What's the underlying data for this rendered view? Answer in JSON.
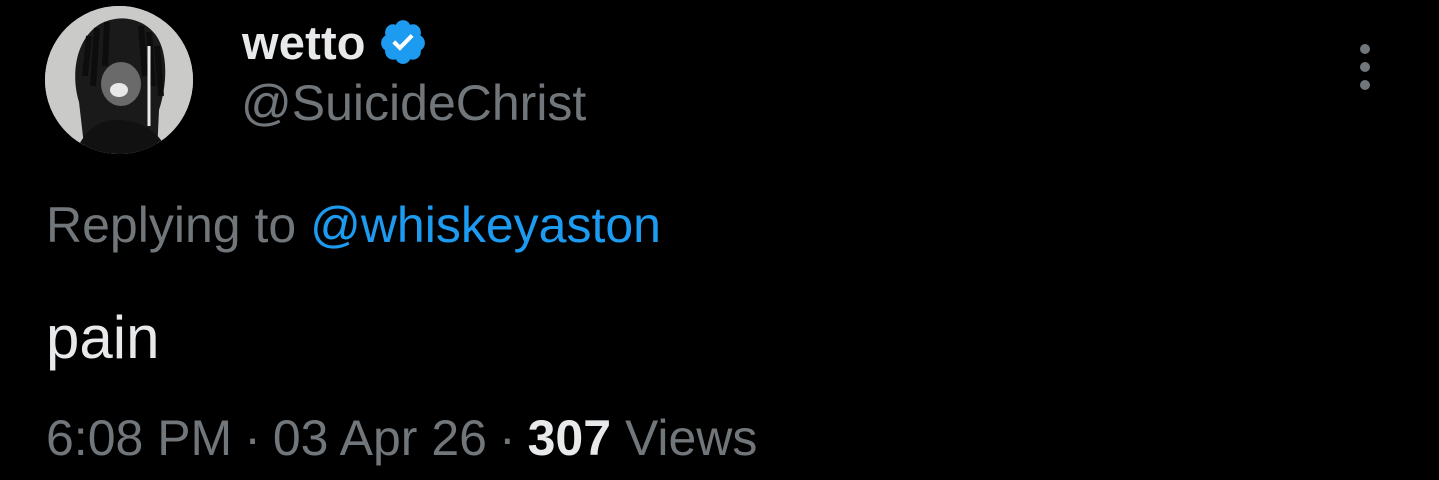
{
  "author": {
    "display_name": "wetto",
    "handle": "@SuicideChrist",
    "verified": true,
    "verified_icon": "verified-badge-icon",
    "avatar_icon": "user-avatar"
  },
  "reply": {
    "prefix": "Replying to",
    "mention": "@whiskeyaston"
  },
  "tweet": {
    "text": "pain"
  },
  "meta": {
    "time": "6:08 PM",
    "separator": "·",
    "date": "03 Apr 26",
    "views_count": "307",
    "views_label": "Views"
  },
  "more_menu": {
    "icon": "more-vertical-icon"
  },
  "colors": {
    "background": "#000000",
    "primary_text": "#e7e9ea",
    "secondary_text": "#71767b",
    "accent": "#1d9bf0"
  }
}
